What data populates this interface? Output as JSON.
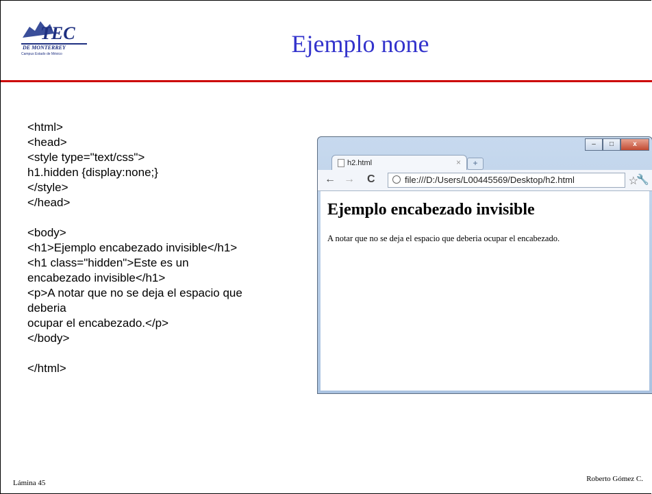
{
  "slide": {
    "title": "Ejemplo none",
    "logo": {
      "main": "TEC",
      "line1": "DE MONTERREY",
      "line2": "Campus Estado de México"
    },
    "code_lines": [
      "<html>",
      "<head>",
      "<style type=\"text/css\">",
      "h1.hidden {display:none;}",
      "</style>",
      "</head>",
      "",
      "<body>",
      "<h1>Ejemplo encabezado invisible</h1>",
      "<h1 class=\"hidden\">Este es un",
      "encabezado invisible</h1>",
      "<p>A notar que no se deja el espacio que",
      "deberia",
      "ocupar el encabezado.</p>",
      "</body>",
      "",
      "</html>"
    ],
    "footer_left": "Lámina 45",
    "footer_right": "Roberto Gómez C."
  },
  "browser": {
    "tab_title": "h2.html",
    "tab_close": "×",
    "new_tab": "+",
    "window_buttons": {
      "minimize": "–",
      "maximize": "□",
      "close": "x"
    },
    "back": "←",
    "forward": "→",
    "reload": "C",
    "address": "file:///D:/Users/L00445569/Desktop/h2.html",
    "star": "☆",
    "wrench": "🔧",
    "page_h1": "Ejemplo encabezado invisible",
    "page_p": "A notar que no se deja el espacio que deberia ocupar el encabezado."
  }
}
